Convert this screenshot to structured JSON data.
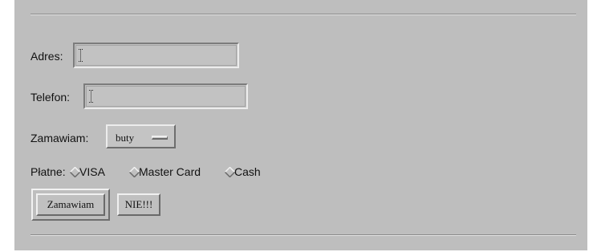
{
  "form": {
    "address": {
      "label": "Adres:",
      "value": ""
    },
    "phone": {
      "label": "Telefon:",
      "value": ""
    },
    "order": {
      "label": "Zamawiam:",
      "selected": "buty"
    },
    "payment": {
      "label": "Płatne:",
      "options": [
        "VISA",
        "Master Card",
        "Cash"
      ],
      "checked_index": null
    },
    "buttons": {
      "submit": "Zamawiam",
      "reset": "NIE!!!"
    }
  },
  "colors": {
    "background": "#bebebe",
    "text": "#111111"
  }
}
